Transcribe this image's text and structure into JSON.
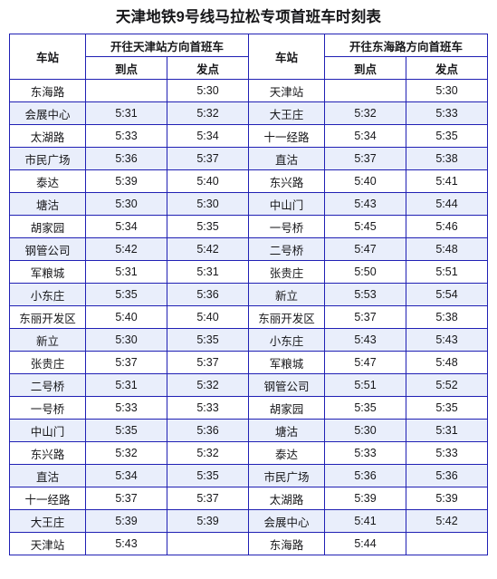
{
  "title": "天津地铁9号线马拉松专项首班车时刻表",
  "header": {
    "station_left": "车站",
    "station_right": "车站",
    "group_left": "开往天津站方向首班车",
    "group_right": "开往东海路方向首班车",
    "arrive": "到点",
    "depart": "发点"
  },
  "rows": [
    {
      "left_station": "东海路",
      "left_arrive": "",
      "left_depart": "5:30",
      "right_station": "天津站",
      "right_arrive": "",
      "right_depart": "5:30"
    },
    {
      "left_station": "会展中心",
      "left_arrive": "5:31",
      "left_depart": "5:32",
      "right_station": "大王庄",
      "right_arrive": "5:32",
      "right_depart": "5:33"
    },
    {
      "left_station": "太湖路",
      "left_arrive": "5:33",
      "left_depart": "5:34",
      "right_station": "十一经路",
      "right_arrive": "5:34",
      "right_depart": "5:35"
    },
    {
      "left_station": "市民广场",
      "left_arrive": "5:36",
      "left_depart": "5:37",
      "right_station": "直沽",
      "right_arrive": "5:37",
      "right_depart": "5:38"
    },
    {
      "left_station": "泰达",
      "left_arrive": "5:39",
      "left_depart": "5:40",
      "right_station": "东兴路",
      "right_arrive": "5:40",
      "right_depart": "5:41"
    },
    {
      "left_station": "塘沽",
      "left_arrive": "5:30",
      "left_depart": "5:30",
      "right_station": "中山门",
      "right_arrive": "5:43",
      "right_depart": "5:44"
    },
    {
      "left_station": "胡家园",
      "left_arrive": "5:34",
      "left_depart": "5:35",
      "right_station": "一号桥",
      "right_arrive": "5:45",
      "right_depart": "5:46"
    },
    {
      "left_station": "钢管公司",
      "left_arrive": "5:42",
      "left_depart": "5:42",
      "right_station": "二号桥",
      "right_arrive": "5:47",
      "right_depart": "5:48"
    },
    {
      "left_station": "军粮城",
      "left_arrive": "5:31",
      "left_depart": "5:31",
      "right_station": "张贵庄",
      "right_arrive": "5:50",
      "right_depart": "5:51"
    },
    {
      "left_station": "小东庄",
      "left_arrive": "5:35",
      "left_depart": "5:36",
      "right_station": "新立",
      "right_arrive": "5:53",
      "right_depart": "5:54"
    },
    {
      "left_station": "东丽开发区",
      "left_arrive": "5:40",
      "left_depart": "5:40",
      "right_station": "东丽开发区",
      "right_arrive": "5:37",
      "right_depart": "5:38"
    },
    {
      "left_station": "新立",
      "left_arrive": "5:30",
      "left_depart": "5:35",
      "right_station": "小东庄",
      "right_arrive": "5:43",
      "right_depart": "5:43"
    },
    {
      "left_station": "张贵庄",
      "left_arrive": "5:37",
      "left_depart": "5:37",
      "right_station": "军粮城",
      "right_arrive": "5:47",
      "right_depart": "5:48"
    },
    {
      "left_station": "二号桥",
      "left_arrive": "5:31",
      "left_depart": "5:32",
      "right_station": "钢管公司",
      "right_arrive": "5:51",
      "right_depart": "5:52"
    },
    {
      "left_station": "一号桥",
      "left_arrive": "5:33",
      "left_depart": "5:33",
      "right_station": "胡家园",
      "right_arrive": "5:35",
      "right_depart": "5:35"
    },
    {
      "left_station": "中山门",
      "left_arrive": "5:35",
      "left_depart": "5:36",
      "right_station": "塘沽",
      "right_arrive": "5:30",
      "right_depart": "5:31"
    },
    {
      "left_station": "东兴路",
      "left_arrive": "5:32",
      "left_depart": "5:32",
      "right_station": "泰达",
      "right_arrive": "5:33",
      "right_depart": "5:33"
    },
    {
      "left_station": "直沽",
      "left_arrive": "5:34",
      "left_depart": "5:35",
      "right_station": "市民广场",
      "right_arrive": "5:36",
      "right_depart": "5:36"
    },
    {
      "left_station": "十一经路",
      "left_arrive": "5:37",
      "left_depart": "5:37",
      "right_station": "太湖路",
      "right_arrive": "5:39",
      "right_depart": "5:39"
    },
    {
      "left_station": "大王庄",
      "left_arrive": "5:39",
      "left_depart": "5:39",
      "right_station": "会展中心",
      "right_arrive": "5:41",
      "right_depart": "5:42"
    },
    {
      "left_station": "天津站",
      "left_arrive": "5:43",
      "left_depart": "",
      "right_station": "东海路",
      "right_arrive": "5:44",
      "right_depart": ""
    }
  ]
}
